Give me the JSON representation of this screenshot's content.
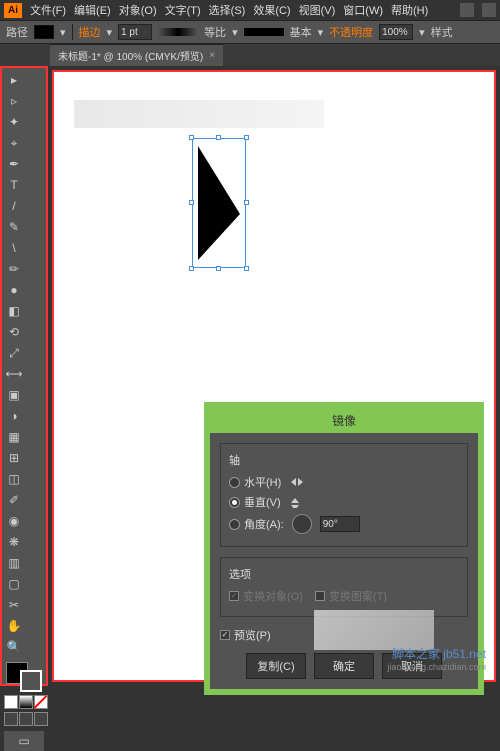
{
  "menubar": {
    "items": [
      "文件(F)",
      "编辑(E)",
      "对象(O)",
      "文字(T)",
      "选择(S)",
      "效果(C)",
      "视图(V)",
      "窗口(W)",
      "帮助(H)"
    ]
  },
  "optionsbar": {
    "label_path": "路径",
    "stroke_label": "描边",
    "stroke_weight": "1 pt",
    "profile1": "等比",
    "profile2": "基本",
    "opacity_label": "不透明度",
    "opacity_value": "100%",
    "style_label": "样式"
  },
  "tab": {
    "title": "未标题-1* @ 100% (CMYK/预览)",
    "close": "×"
  },
  "dialog": {
    "title": "镜像",
    "axis_label": "轴",
    "horizontal": "水平(H)",
    "vertical": "垂直(V)",
    "angle_label": "角度(A):",
    "angle_value": "90°",
    "options_label": "选项",
    "transform_objects": "变换对象(O)",
    "transform_patterns": "变换图案(T)",
    "preview": "预览(P)",
    "btn_copy": "复制(C)",
    "btn_ok": "确定",
    "btn_cancel": "取消"
  },
  "watermark": {
    "line1": "脚本之家 jb51.net",
    "line2": "jiaocheng.chazidian.com"
  },
  "tool_icons": [
    "▸",
    "▹",
    "✦",
    "⌖",
    "T",
    "/",
    "\\",
    "✎",
    "▭",
    "◔",
    "⬚",
    "▦",
    "⟲",
    "▤",
    "⤢",
    "▥",
    "✂",
    "◐",
    "✥",
    "⊞",
    "▦",
    "▩",
    "✋",
    "🔍"
  ]
}
